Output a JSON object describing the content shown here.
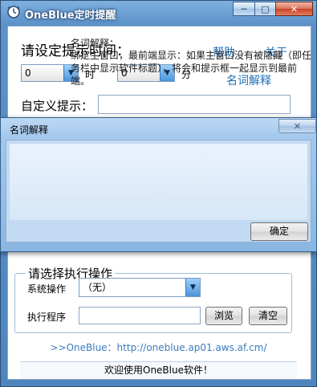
{
  "main_window": {
    "title": "OneBlue定时提醒",
    "controls": {
      "minimize": "─",
      "maximize": "□",
      "close": "✕"
    },
    "set_time_label": "请设定提示时间：",
    "help_link": "帮助",
    "about_link": "关于",
    "glossary_link": "名词解释",
    "hour": {
      "value": "0",
      "unit": "时"
    },
    "minute": {
      "value": "0",
      "unit": "分"
    },
    "custom_prompt_label": "自定义提示：",
    "custom_prompt_value": "",
    "action_group": {
      "title": "请选择执行操作",
      "system_action_label": "系统操作",
      "system_action_value": "（无）",
      "program_label": "执行程序",
      "program_value": "",
      "browse_button": "浏览",
      "clear_button": "清空"
    },
    "url_text": ">>OneBlue：http://oneblue.ap01.aws.af.cm/",
    "status_text": "欢迎使用OneBlue软件！"
  },
  "dialog": {
    "title": "名词解释",
    "heading": "名词解释：",
    "body": "绑定主窗口，最前端显示：如果主窗口没有被隐藏（即任务栏中显示软件标题），将会和提示框一起显示到最前端。",
    "ok_button": "确定",
    "close_glyph": "✕"
  },
  "colors": {
    "window_frame": "#5c92c9",
    "link": "#1e6fb5",
    "url_text": "#3a7bbf",
    "close_red": "#c9442a"
  },
  "icons": {
    "app": "clock-icon",
    "dropdown": "chevron-down-icon"
  }
}
